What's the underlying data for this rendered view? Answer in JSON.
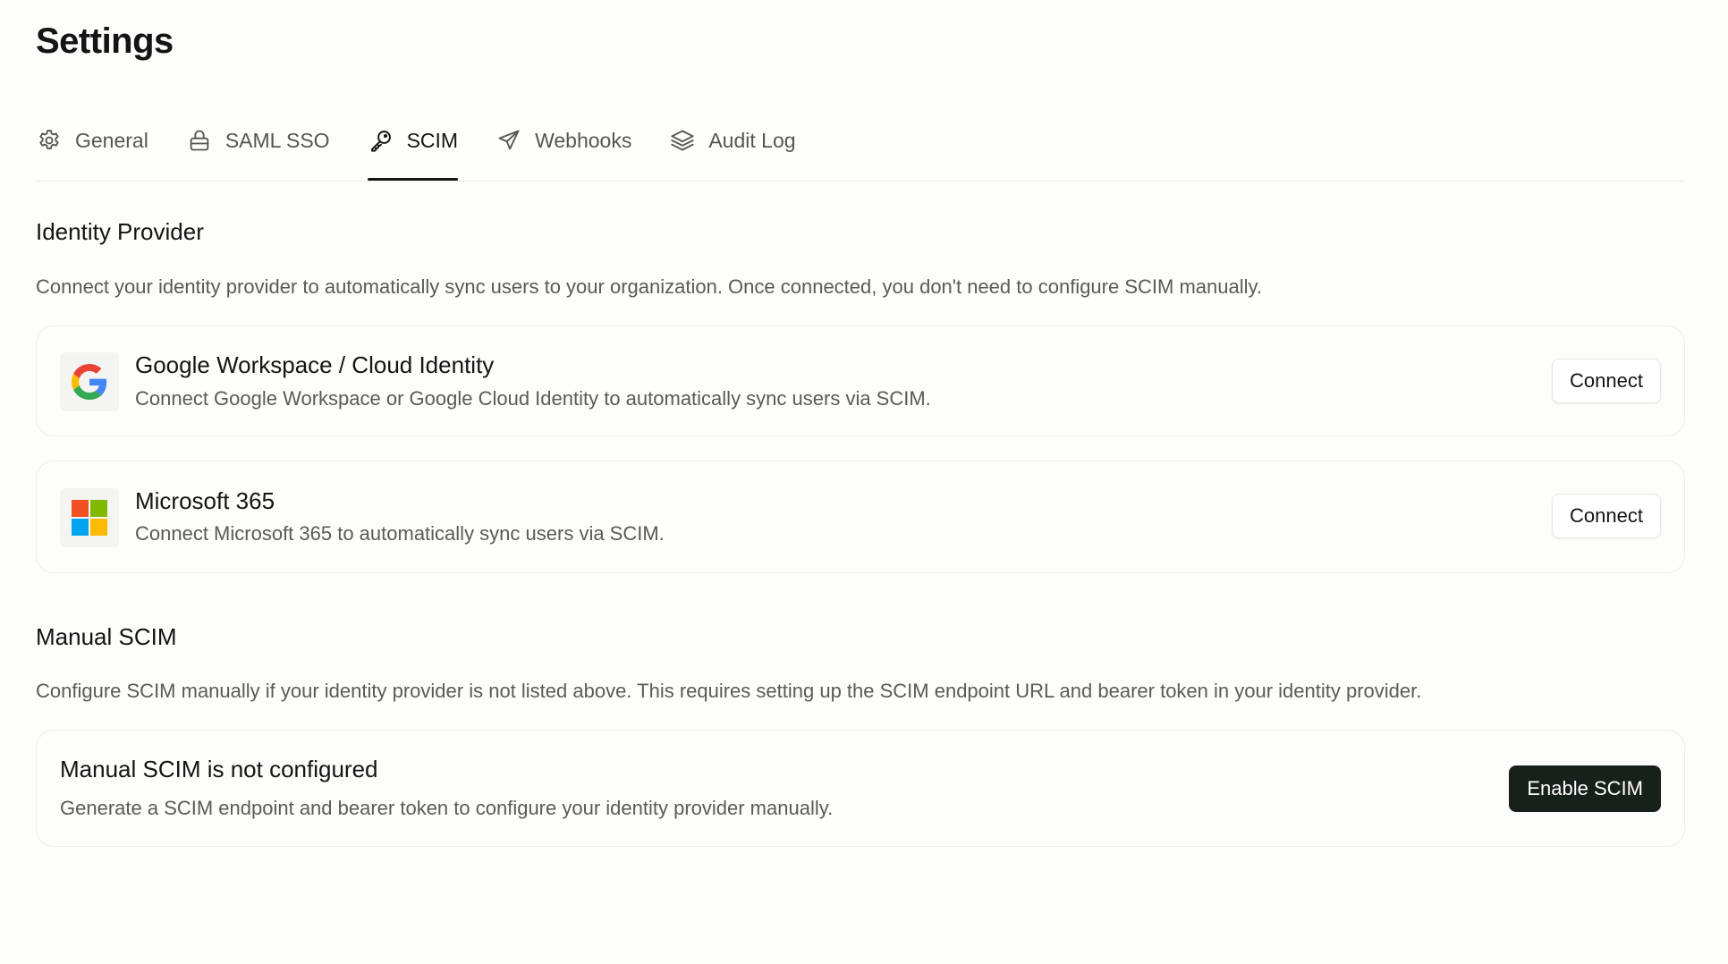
{
  "page": {
    "title": "Settings"
  },
  "tabs": [
    {
      "label": "General",
      "icon": "gear-icon",
      "active": false
    },
    {
      "label": "SAML SSO",
      "icon": "lock-icon",
      "active": false
    },
    {
      "label": "SCIM",
      "icon": "key-icon",
      "active": true
    },
    {
      "label": "Webhooks",
      "icon": "send-icon",
      "active": false
    },
    {
      "label": "Audit Log",
      "icon": "layers-icon",
      "active": false
    }
  ],
  "identity_provider": {
    "title": "Identity Provider",
    "description": "Connect your identity provider to automatically sync users to your organization. Once connected, you don't need to configure SCIM manually.",
    "providers": [
      {
        "name": "Google Workspace / Cloud Identity",
        "description": "Connect Google Workspace or Google Cloud Identity to automatically sync users via SCIM.",
        "icon": "google-logo-icon",
        "button_label": "Connect"
      },
      {
        "name": "Microsoft 365",
        "description": "Connect Microsoft 365 to automatically sync users via SCIM.",
        "icon": "microsoft-logo-icon",
        "button_label": "Connect"
      }
    ]
  },
  "manual_scim": {
    "title": "Manual SCIM",
    "description": "Configure SCIM manually if your identity provider is not listed above. This requires setting up the SCIM endpoint URL and bearer token in your identity provider.",
    "status_title": "Manual SCIM is not configured",
    "status_description": "Generate a SCIM endpoint and bearer token to configure your identity provider manually.",
    "button_label": "Enable SCIM"
  },
  "colors": {
    "background": "#fdfdfb",
    "text_primary": "#141414",
    "text_secondary": "#5a5a58",
    "border": "#ededeb",
    "primary_button": "#17201a",
    "google_blue": "#4285F4",
    "google_red": "#EA4335",
    "google_yellow": "#FBBC05",
    "google_green": "#34A853",
    "ms_red": "#F25022",
    "ms_green": "#7FBA00",
    "ms_blue": "#00A4EF",
    "ms_yellow": "#FFB900"
  }
}
